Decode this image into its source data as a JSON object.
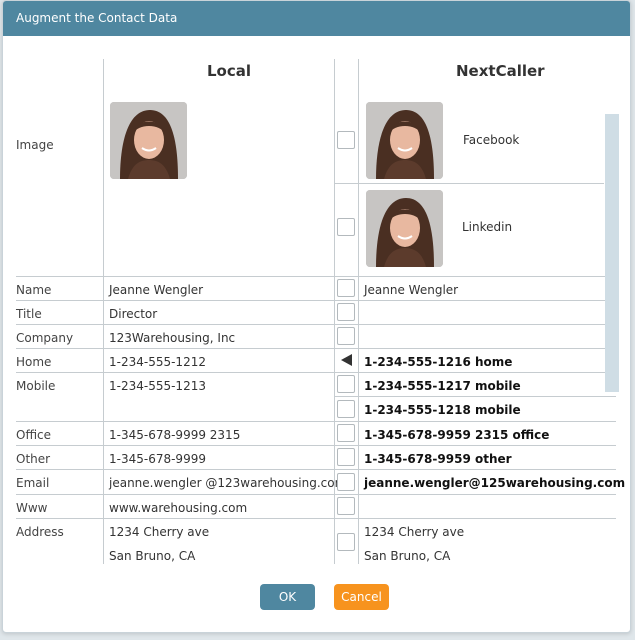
{
  "dialog": {
    "title": "Augment the Contact Data"
  },
  "columns": {
    "local": "Local",
    "remote": "NextCaller"
  },
  "image_row": {
    "label": "Image",
    "sources": [
      {
        "name": "Facebook"
      },
      {
        "name": "Linkedin"
      }
    ]
  },
  "rows": {
    "name": {
      "label": "Name",
      "local": "Jeanne Wengler",
      "remote": "Jeanne Wengler"
    },
    "title": {
      "label": "Title",
      "local": "Director",
      "remote": ""
    },
    "company": {
      "label": "Company",
      "local": "123Warehousing, Inc",
      "remote": ""
    },
    "home": {
      "label": "Home",
      "local": "1-234-555-1212",
      "remote": "1-234-555-1216 home"
    },
    "mobile": {
      "label": "Mobile",
      "local": "1-234-555-1213",
      "remote": [
        "1-234-555-1217 mobile",
        "1-234-555-1218 mobile"
      ]
    },
    "office": {
      "label": "Office",
      "local": "1-345-678-9999 2315",
      "remote": "1-345-678-9959 2315 office"
    },
    "other": {
      "label": "Other",
      "local": "1-345-678-9999",
      "remote": "1-345-678-9959 other"
    },
    "email": {
      "label": "Email",
      "local": "jeanne.wengler @123warehousing.com",
      "remote": "jeanne.wengler@125warehousing.com"
    },
    "www": {
      "label": "Www",
      "local": "www.warehousing.com",
      "remote": ""
    },
    "address": {
      "label": "Address",
      "local": [
        "1234 Cherry ave",
        "San Bruno, CA"
      ],
      "remote": [
        "1234 Cherry ave",
        "San Bruno, CA"
      ]
    }
  },
  "buttons": {
    "ok": "OK",
    "cancel": "Cancel"
  },
  "colors": {
    "titlebar": "#4f87a0",
    "cancel": "#f7931e",
    "ok": "#4f87a0"
  },
  "icons": {
    "home_select": "left-arrow-icon"
  }
}
